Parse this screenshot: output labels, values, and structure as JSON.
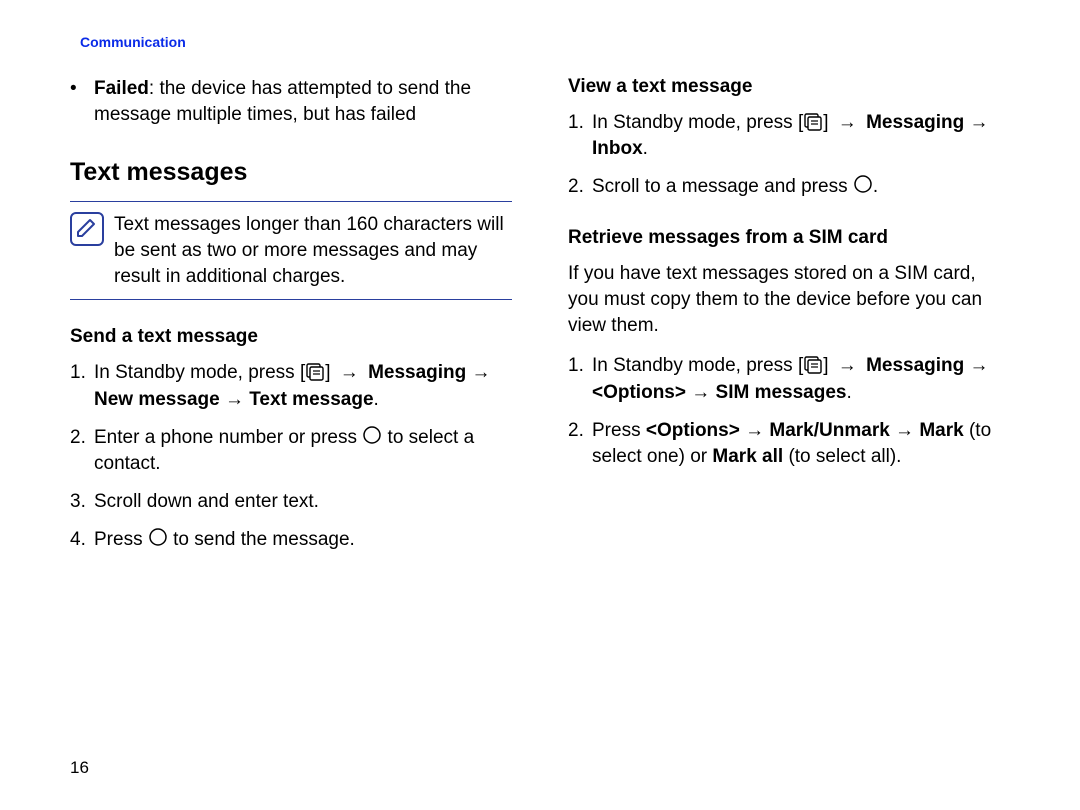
{
  "header": {
    "section": "Communication"
  },
  "pageNumber": "16",
  "arrow": "→",
  "icons": {
    "note": "note-pencil-icon",
    "menu": "menu-key-icon",
    "ok": "ok-key-icon"
  },
  "left": {
    "bullet": {
      "label": "Failed",
      "rest": ": the device has attempted to send the message multiple times, but has failed"
    },
    "heading": "Text messages",
    "note": "Text messages longer than 160 characters will be sent as two or more messages and may result in additional charges.",
    "send": {
      "title": "Send a text message",
      "step1_lead": "In Standby mode, press [",
      "step1_tail": "] ",
      "step1_path": "Messaging → New message → Text message",
      "step1_dot": ".",
      "step2_a": "Enter a phone number or press ",
      "step2_b": " to select a contact.",
      "step3": "Scroll down and enter text.",
      "step4_a": "Press ",
      "step4_b": " to send the message."
    }
  },
  "right": {
    "view": {
      "title": "View a text message",
      "step1_lead": "In Standby mode, press [",
      "step1_tail": "] ",
      "step1_path": "Messaging → Inbox",
      "step1_dot": ".",
      "step2_a": "Scroll to a message and press ",
      "step2_dot": "."
    },
    "sim": {
      "title": "Retrieve messages from a SIM card",
      "intro": "If you have text messages stored on a SIM card, you must copy them to the device before you can view them.",
      "step1_lead": "In Standby mode, press [",
      "step1_tail": "] ",
      "step1_path": "Messaging → <Options> → SIM messages",
      "step1_dot": ".",
      "step2_a": "Press ",
      "step2_b": "<Options>",
      "step2_c": " → ",
      "step2_d": "Mark/Unmark",
      "step2_e": " → ",
      "step2_f": "Mark",
      "step2_g": " (to select one) or ",
      "step2_h": "Mark all",
      "step2_i": " (to select all)."
    }
  }
}
